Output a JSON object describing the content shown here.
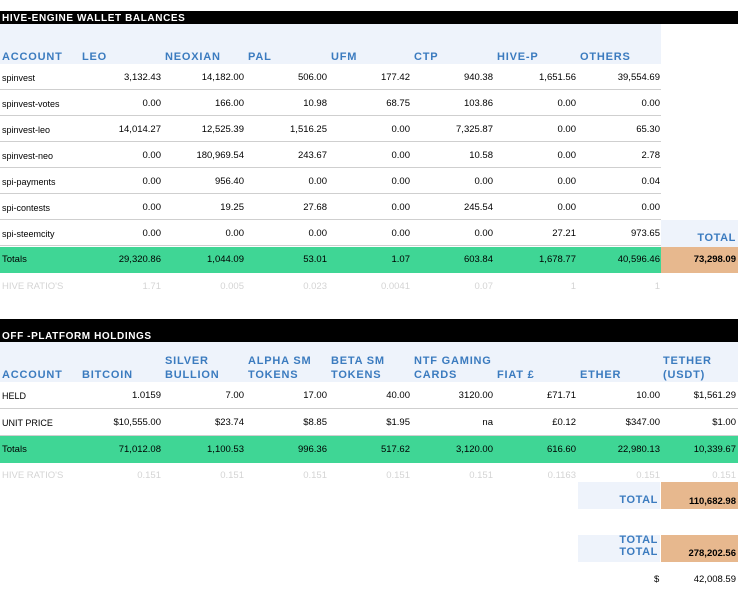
{
  "section1": {
    "title": "HIVE-ENGINE WALLET BALANCES",
    "headers": [
      "ACCOUNT",
      "LEO",
      "NEOXIAN",
      "PAL",
      "UFM",
      "CTP",
      "HIVE-P",
      "OTHERS"
    ],
    "rows": [
      {
        "name": "spinvest",
        "vals": [
          "3,132.43",
          "14,182.00",
          "506.00",
          "177.42",
          "940.38",
          "1,651.56",
          "39,554.69"
        ]
      },
      {
        "name": "spinvest-votes",
        "vals": [
          "0.00",
          "166.00",
          "10.98",
          "68.75",
          "103.86",
          "0.00",
          "0.00"
        ]
      },
      {
        "name": "spinvest-leo",
        "vals": [
          "14,014.27",
          "12,525.39",
          "1,516.25",
          "0.00",
          "7,325.87",
          "0.00",
          "65.30"
        ]
      },
      {
        "name": "spinvest-neo",
        "vals": [
          "0.00",
          "180,969.54",
          "243.67",
          "0.00",
          "10.58",
          "0.00",
          "2.78"
        ]
      },
      {
        "name": "spi-payments",
        "vals": [
          "0.00",
          "956.40",
          "0.00",
          "0.00",
          "0.00",
          "0.00",
          "0.04"
        ]
      },
      {
        "name": "spi-contests",
        "vals": [
          "0.00",
          "19.25",
          "27.68",
          "0.00",
          "245.54",
          "0.00",
          "0.00"
        ]
      },
      {
        "name": "spi-steemcity",
        "vals": [
          "0.00",
          "0.00",
          "0.00",
          "0.00",
          "0.00",
          "27.21",
          "973.65"
        ]
      }
    ],
    "totals_label": "Totals",
    "totals": [
      "29,320.86",
      "1,044.09",
      "53.01",
      "1.07",
      "603.84",
      "1,678.77",
      "40,596.46"
    ],
    "total_header": "TOTAL",
    "grand_total": "73,298.09",
    "ratio_label": "HIVE RATIO'S",
    "ratios": [
      "1.71",
      "0.005",
      "0.023",
      "0.0041",
      "0.07",
      "1",
      "1"
    ]
  },
  "section2": {
    "title": "OFF -PLATFORM HOLDINGS",
    "headers": [
      {
        "l1": "",
        "l2": "ACCOUNT"
      },
      {
        "l1": "",
        "l2": "BITCOIN"
      },
      {
        "l1": "SILVER",
        "l2": "BULLION"
      },
      {
        "l1": "ALPHA SM",
        "l2": "TOKENS"
      },
      {
        "l1": "BETA SM",
        "l2": "TOKENS"
      },
      {
        "l1": "NTF GAMING",
        "l2": "CARDS"
      },
      {
        "l1": "",
        "l2": "FIAT £"
      },
      {
        "l1": "",
        "l2": "ETHER"
      },
      {
        "l1": "TETHER",
        "l2": "(USDT)"
      }
    ],
    "rows": [
      {
        "name": "HELD",
        "vals": [
          "1.0159",
          "7.00",
          "17.00",
          "40.00",
          "3120.00",
          "£71.71",
          "10.00",
          "$1,561.29"
        ]
      },
      {
        "name": "UNIT PRICE",
        "vals": [
          "$10,555.00",
          "$23.74",
          "$8.85",
          "$1.95",
          "na",
          "£0.12",
          "$347.00",
          "$1.00"
        ]
      }
    ],
    "totals_label": "Totals",
    "totals": [
      "71,012.08",
      "1,100.53",
      "996.36",
      "517.62",
      "3,120.00",
      "616.60",
      "22,980.13",
      "10,339.67"
    ],
    "ratio_label": "HIVE RATIO'S",
    "ratios": [
      "0.151",
      "0.151",
      "0.151",
      "0.151",
      "0.151",
      "0.1163",
      "0.151",
      "0.151"
    ],
    "total_label": "TOTAL",
    "total_value": "110,682.98"
  },
  "summary": {
    "label_line1": "TOTAL",
    "label_line2": "TOTAL",
    "grand_value": "278,202.56",
    "currency_symbol": "$",
    "usd_value": "42,008.59"
  },
  "colors": {
    "header_blue": "#3b7bbf",
    "totals_green": "#3fd695",
    "total_tan": "#e7b88e",
    "header_bg": "#eef3fb"
  }
}
